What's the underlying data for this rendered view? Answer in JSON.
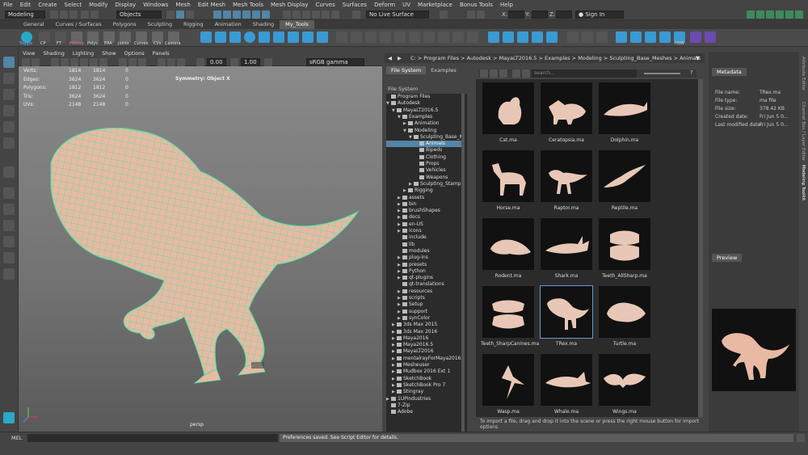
{
  "menubar": [
    "File",
    "Edit",
    "Create",
    "Select",
    "Modify",
    "Display",
    "Windows",
    "Mesh",
    "Edit Mesh",
    "Mesh Tools",
    "Mesh Display",
    "Curves",
    "Surfaces",
    "Deform",
    "UV",
    "Marketplace",
    "Bonus Tools",
    "Help"
  ],
  "status": {
    "mode": "Modeling",
    "objects": "Objects",
    "live_surface": "No Live Surface",
    "x": "X:",
    "y": "Y:",
    "z": "Z:",
    "sign_in": "Sign In"
  },
  "shelf_tabs": [
    "General",
    "Curves / Surfaces",
    "Polygons",
    "Sculpting",
    "Rigging",
    "Animation",
    "Shading",
    "My_Tools"
  ],
  "shelf_labels": [
    "Toggle",
    "CP",
    "FT",
    "History",
    "Polys",
    "ERA",
    "Joints",
    "Curves",
    "CVs",
    "Camera",
    "HSW"
  ],
  "viewport": {
    "menu": [
      "View",
      "Shading",
      "Lighting",
      "Show",
      "Options",
      "Panels"
    ],
    "exposure": "0.00",
    "gamma": "1.00",
    "colorspace": "sRGB gamma",
    "symmetry": "Symmetry: Object X",
    "camera": "persp",
    "hud": [
      {
        "label": "Verts:",
        "a": "1814",
        "b": "1814",
        "c": "0"
      },
      {
        "label": "Edges:",
        "a": "3624",
        "b": "3624",
        "c": "0"
      },
      {
        "label": "Polygons:",
        "a": "1812",
        "b": "1812",
        "c": "0"
      },
      {
        "label": "Tris:",
        "a": "3624",
        "b": "3624",
        "c": "0"
      },
      {
        "label": "UVs:",
        "a": "2148",
        "b": "2148",
        "c": "0"
      }
    ]
  },
  "browser": {
    "path": "C: > Program Files > Autodesk > MayaLT2016.5 > Examples > Modeling > Sculpting_Base_Meshes > Animals",
    "tabs": [
      "File System",
      "Examples"
    ],
    "section_label": "File System",
    "search_placeholder": "search...",
    "tree": [
      {
        "label": "Program Files",
        "indent": 0,
        "arrow": ""
      },
      {
        "label": "Autodesk",
        "indent": 0,
        "arrow": "▼"
      },
      {
        "label": "MayaLT2016.5",
        "indent": 1,
        "arrow": "▼"
      },
      {
        "label": "Examples",
        "indent": 2,
        "arrow": "▼"
      },
      {
        "label": "Animation",
        "indent": 3,
        "arrow": "▶"
      },
      {
        "label": "Modeling",
        "indent": 3,
        "arrow": "▼"
      },
      {
        "label": "Sculpting_Base_M",
        "indent": 4,
        "arrow": "▼"
      },
      {
        "label": "Animals",
        "indent": 5,
        "arrow": "",
        "selected": true
      },
      {
        "label": "Bipeds",
        "indent": 5,
        "arrow": ""
      },
      {
        "label": "Clothing",
        "indent": 5,
        "arrow": ""
      },
      {
        "label": "Props",
        "indent": 5,
        "arrow": ""
      },
      {
        "label": "Vehicles",
        "indent": 5,
        "arrow": ""
      },
      {
        "label": "Weapons",
        "indent": 5,
        "arrow": ""
      },
      {
        "label": "Sculpting_Stamp",
        "indent": 4,
        "arrow": "▶"
      },
      {
        "label": "Rigging",
        "indent": 3,
        "arrow": "▶"
      },
      {
        "label": "assets",
        "indent": 2,
        "arrow": "▶"
      },
      {
        "label": "bin",
        "indent": 2,
        "arrow": "▶"
      },
      {
        "label": "brushShapes",
        "indent": 2,
        "arrow": "▶"
      },
      {
        "label": "docs",
        "indent": 2,
        "arrow": "▶"
      },
      {
        "label": "en-US",
        "indent": 2,
        "arrow": "▶"
      },
      {
        "label": "icons",
        "indent": 2,
        "arrow": "▶"
      },
      {
        "label": "include",
        "indent": 2,
        "arrow": ""
      },
      {
        "label": "lib",
        "indent": 2,
        "arrow": ""
      },
      {
        "label": "modules",
        "indent": 2,
        "arrow": ""
      },
      {
        "label": "plug-ins",
        "indent": 2,
        "arrow": "▶"
      },
      {
        "label": "presets",
        "indent": 2,
        "arrow": "▶"
      },
      {
        "label": "Python",
        "indent": 2,
        "arrow": "▶"
      },
      {
        "label": "qt-plugins",
        "indent": 2,
        "arrow": "▶"
      },
      {
        "label": "qt-translations",
        "indent": 2,
        "arrow": ""
      },
      {
        "label": "resources",
        "indent": 2,
        "arrow": "▶"
      },
      {
        "label": "scripts",
        "indent": 2,
        "arrow": "▶"
      },
      {
        "label": "Setup",
        "indent": 2,
        "arrow": "▶"
      },
      {
        "label": "support",
        "indent": 2,
        "arrow": "▶"
      },
      {
        "label": "synColor",
        "indent": 2,
        "arrow": "▶"
      },
      {
        "label": "3ds Max 2015",
        "indent": 1,
        "arrow": "▶"
      },
      {
        "label": "3ds Max 2016",
        "indent": 1,
        "arrow": "▶"
      },
      {
        "label": "Maya2016",
        "indent": 1,
        "arrow": "▶"
      },
      {
        "label": "Maya2016.5",
        "indent": 1,
        "arrow": "▶"
      },
      {
        "label": "MayaLT2016",
        "indent": 1,
        "arrow": "▶"
      },
      {
        "label": "mentalrayForMaya2016",
        "indent": 1,
        "arrow": "▶"
      },
      {
        "label": "Mesheuser",
        "indent": 1,
        "arrow": "▶"
      },
      {
        "label": "Mudbox 2016 Ext 1",
        "indent": 1,
        "arrow": "▶"
      },
      {
        "label": "SketchBook",
        "indent": 1,
        "arrow": "▶"
      },
      {
        "label": "SketchBook Pro 7",
        "indent": 1,
        "arrow": "▶"
      },
      {
        "label": "Stingray",
        "indent": 1,
        "arrow": "▶"
      },
      {
        "label": "1UPindustries",
        "indent": 0,
        "arrow": "▶"
      },
      {
        "label": "7-Zip",
        "indent": 0,
        "arrow": ""
      },
      {
        "label": "Adobe",
        "indent": 0,
        "arrow": ""
      }
    ],
    "files": [
      "Cat.ma",
      "Ceratopsia.ma",
      "Dolphin.ma",
      "Horse.ma",
      "Raptor.ma",
      "Reptile.ma",
      "Rodent.ma",
      "Shark.ma",
      "Teeth_AllSharp.ma",
      "Teeth_SharpCanines.ma",
      "TRex.ma",
      "Turtle.ma",
      "Wasp.ma",
      "Whale.ma",
      "Wings.ma"
    ],
    "selected_file": "TRex.ma",
    "hint": "To import a file, drag and drop it into the scene or press the right mouse button for import options"
  },
  "metadata": {
    "tab": "Metadata",
    "rows": [
      {
        "label": "File name:",
        "value": "TRex.ma"
      },
      {
        "label": "File type:",
        "value": "ma file"
      },
      {
        "label": "File size:",
        "value": "378.42 KB"
      },
      {
        "label": "Created date:",
        "value": "Fri Jun 5 0..."
      },
      {
        "label": "Last modified date:",
        "value": "Fri Jun 5 0..."
      }
    ],
    "preview_tab": "Preview"
  },
  "side_tabs": [
    "Attribute Editor",
    "Channel Box / Layer Editor",
    "Modeling Toolkit"
  ],
  "cmdline": {
    "lang": "MEL",
    "result": "Preferences saved. See Script Editor for details."
  },
  "colors": {
    "accent": "#5285a6",
    "wire": "#3ee6a4",
    "mesh": "#e8b9a3"
  }
}
